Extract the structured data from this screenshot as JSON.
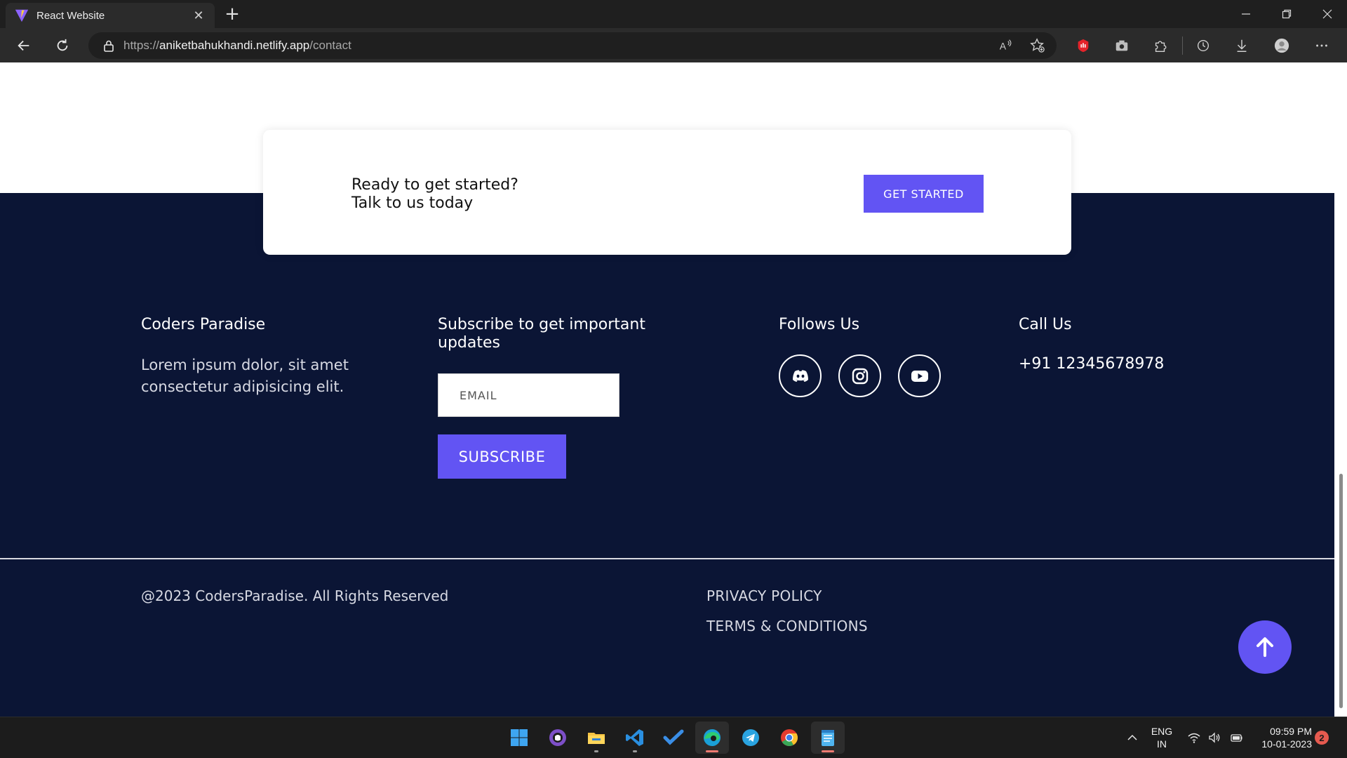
{
  "browser": {
    "tab_title": "React Website",
    "url_scheme": "https://",
    "url_host": "aniketbahukhandi.netlify.app",
    "url_path": "/contact",
    "toolbar_icons": [
      "read-aloud-icon",
      "favorites-add-icon",
      "extension-red-icon",
      "screenshot-icon",
      "extensions-icon",
      "history-icon",
      "downloads-icon",
      "profile-icon",
      "more-icon"
    ]
  },
  "cta": {
    "line1": "Ready to get started?",
    "line2": "Talk to us today",
    "button": "GET STARTED"
  },
  "footer": {
    "brand": {
      "title": "Coders Paradise",
      "text_line1": "Lorem ipsum dolor, sit amet",
      "text_line2": "consectetur adipisicing elit."
    },
    "subscribe": {
      "title_line1": "Subscribe to get important",
      "title_line2": "updates",
      "email_placeholder": "EMAIL",
      "button": "SUBSCRIBE"
    },
    "follow": {
      "title": "Follows Us",
      "icons": [
        "discord-icon",
        "instagram-icon",
        "youtube-icon"
      ]
    },
    "call": {
      "title": "Call Us",
      "phone": "+91 12345678978"
    },
    "copyright": "@2023 CodersParadise. All Rights Reserved",
    "links": [
      "PRIVACY POLICY",
      "TERMS & CONDITIONS"
    ]
  },
  "taskbar": {
    "apps": [
      "windows-start-icon",
      "github-desktop-icon",
      "file-explorer-icon",
      "vscode-icon",
      "todo-icon",
      "edge-icon",
      "telegram-icon",
      "chrome-icon",
      "notepad-icon"
    ],
    "lang_line1": "ENG",
    "lang_line2": "IN",
    "time": "09:59 PM",
    "date": "10-01-2023",
    "notifications": "2"
  },
  "colors": {
    "accent": "#6254f3",
    "footer_bg": "#0b1535",
    "chrome_bg": "#2b2b2b"
  }
}
